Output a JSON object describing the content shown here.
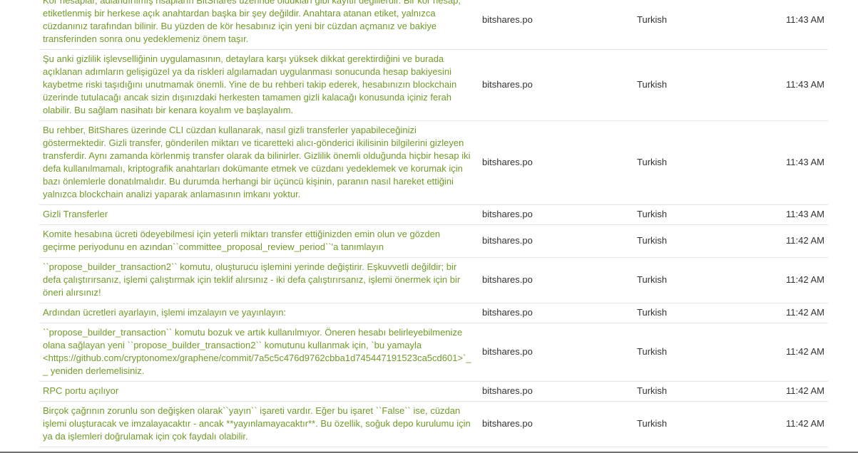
{
  "rows": [
    {
      "text": "Kör hesaplar, adlandırılmış hsapların BitShares üzerinde oldukları gibi kayıtlı değillerdir. Bir kör hesap, etiketlenmiş bir herkese açık anahtardan başka bir şey değildir. Anahtara atanan etiket, yalnızca cüzdanınız tarafından bilinir. Bu yüzden de kör hesabınız için yeni bir cüzdan açmanız ve bakiye transferinden sonra onu yedeklemeniz önem taşır.",
      "project": "bitshares.po",
      "language": "Turkish",
      "time": "11:43 AM"
    },
    {
      "text": "Şu anki gizlilik işlevselliğinin uygulamasının, detaylara karşı yüksek dikkat gerektirdiğini ve burada açıklanan adımların gelişigüzel ya da riskleri algılamadan uygulanması sonucunda hesap bakiyesini kaybetme riski taşıdığını unutmamak önemli. Yine de bu rehberi takip ederek, hesabınızın blockchain üzerinde tutulacağı ancak sizin dışınızdaki herkesten tamamen gizli kalacağı konusunda içiniz ferah olabilir. Bu sağlam nasihatı bir kenara koyalım ve başlayalım.",
      "project": "bitshares.po",
      "language": "Turkish",
      "time": "11:43 AM"
    },
    {
      "text": "Bu rehber, BitShares üzerinde CLI cüzdan kullanarak, nasıl gizli transferler yapabileceğinizi göstermektedir. Gizli transfer, gönderilen miktarı ve ticaretteki alıcı-gönderici ikilisinin bilgilerini gizleyen transferdir. Aynı zamanda körlenmiş transfer olarak da bilinirler. Gizlilik önemli olduğunda hiçbir hesap iki defa kullanılmamalı, kriptografik anahtarları dokümante etmek ve cüzdanı yedeklemek ve korumak için bazı önlemlerle donatılmalıdır. Bu durumda herhangi bir üçüncü kişinin, paranın nasıl hareket ettiğini yalnızca blockchain analizi yaparak anlamasının imkanı yoktur.",
      "project": "bitshares.po",
      "language": "Turkish",
      "time": "11:43 AM"
    },
    {
      "text": "Gizli Transferler",
      "project": "bitshares.po",
      "language": "Turkish",
      "time": "11:43 AM"
    },
    {
      "text": "Komite hesabına ücreti ödeyebilmesi için yeterli miktarı transfer ettiğinizden emin olun ve gözden geçirme periyodunu en azından``committee_proposal_review_period``'a tanımlayın",
      "project": "bitshares.po",
      "language": "Turkish",
      "time": "11:42 AM"
    },
    {
      "text": "``propose_builder_transaction2`` komutu, oluşturucu işlemini yerinde değiştirir. Eşkuvvetli değildir; bir defa çalıştırırsanız, işlemi çalıştırmak için teklif alırsınız - iki defa çalıştırırsanız, işlemi önermek için bir öneri alırsınız!",
      "project": "bitshares.po",
      "language": "Turkish",
      "time": "11:42 AM"
    },
    {
      "text": "Ardından ücretleri ayarlayın, işlemi imzalayın ve yayınlayın:",
      "project": "bitshares.po",
      "language": "Turkish",
      "time": "11:42 AM"
    },
    {
      "text": "``propose_builder_transaction`` komutu bozuk ve artık kullanılmıyor. Öneren hesabı belirleyebilmenize olana sağlayan yeni ``propose_builder_transaction2`` komutunu kullanmak için, `bu yamayla <https://github.com/cryptonomex/graphene/commit/7a5c5c476d9762cbba1d745447191523ca5cd601>`__ yeniden derlemelisiniz.",
      "project": "bitshares.po",
      "language": "Turkish",
      "time": "11:42 AM"
    },
    {
      "text": "RPC portu açılıyor",
      "project": "bitshares.po",
      "language": "Turkish",
      "time": "11:42 AM"
    },
    {
      "text": "Birçok çağrının zorunlu son değişken olarak``yayın`` işareti vardır. Eğer bu işaret ``False`` ise, cüzdan işlemi oluşturacak ve imzalayacaktır - ancak **yayınlamayacaktır**. Bu özellik, soğuk depo kurulumu için ya da işlemleri doğrulamak için çok faydalı olabilir.",
      "project": "bitshares.po",
      "language": "Turkish",
      "time": "11:42 AM"
    }
  ]
}
